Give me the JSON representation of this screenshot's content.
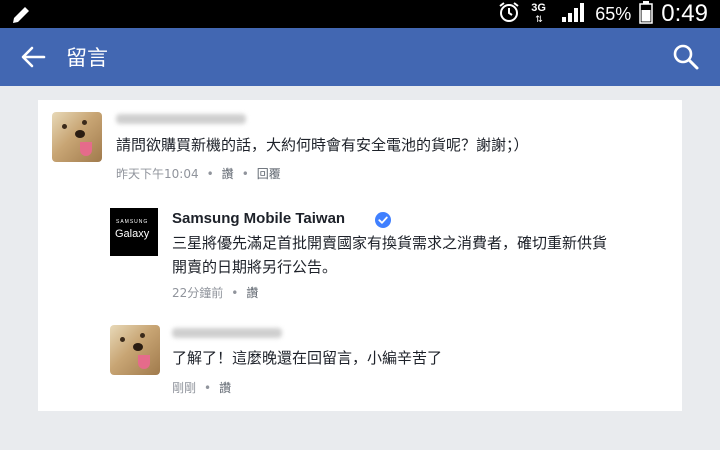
{
  "status_bar": {
    "network": "3G",
    "battery": "65%",
    "time": "0:49"
  },
  "app_bar": {
    "title": "留言"
  },
  "comments": [
    {
      "text": "請問欲購買新機的話，大約何時會有安全電池的貨呢？謝謝；）",
      "time": "昨天下午10:04",
      "like_label": "讚",
      "reply_label": "回覆"
    }
  ],
  "replies": [
    {
      "author": "Samsung Mobile Taiwan",
      "logo_line1": "SAMSUNG",
      "logo_line2": "Galaxy",
      "text_line1": "三星將優先滿足首批開賣國家有換貨需求之消費者，確切重新供貨",
      "text_line2": "開賣的日期將另行公告。",
      "time": "22分鐘前",
      "like_label": "讚"
    },
    {
      "text": "了解了！這麼晚還在回留言，小編辛苦了",
      "time": "剛剛",
      "like_label": "讚"
    }
  ],
  "colors": {
    "app_bar": "#4267b2",
    "verified": "#4080ff",
    "background": "#e9ebee"
  }
}
